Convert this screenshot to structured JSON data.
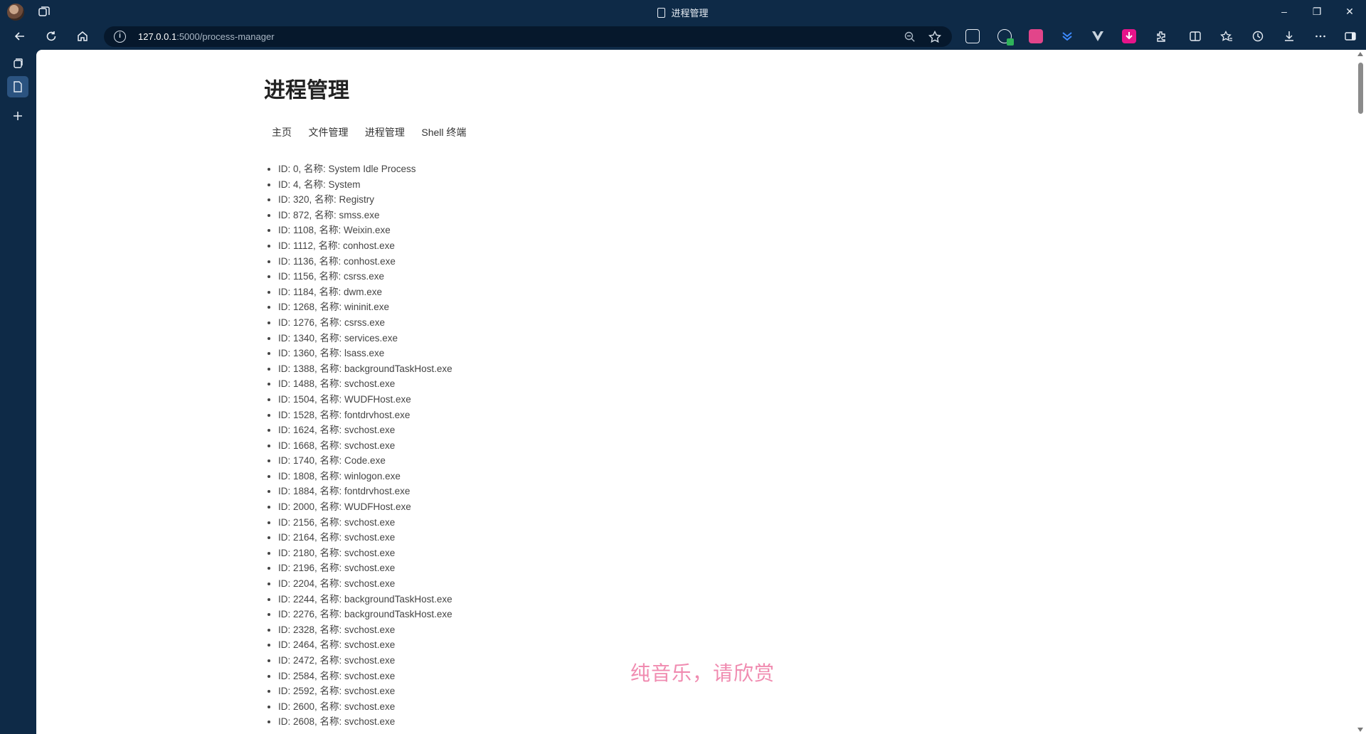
{
  "window": {
    "title": "进程管理",
    "controls": {
      "minimize": "–",
      "restore": "❐",
      "close": "✕"
    }
  },
  "toolbar": {
    "url_host": "127.0.0.1",
    "url_rest": ":5000/process-manager"
  },
  "page": {
    "title": "进程管理",
    "nav": [
      "主页",
      "文件管理",
      "进程管理",
      "Shell 终端"
    ],
    "label_id": "ID",
    "label_name": "名称",
    "processes": [
      "ID: 0, 名称: System Idle Process",
      "ID: 4, 名称: System",
      "ID: 320, 名称: Registry",
      "ID: 872, 名称: smss.exe",
      "ID: 1108, 名称: Weixin.exe",
      "ID: 1112, 名称: conhost.exe",
      "ID: 1136, 名称: conhost.exe",
      "ID: 1156, 名称: csrss.exe",
      "ID: 1184, 名称: dwm.exe",
      "ID: 1268, 名称: wininit.exe",
      "ID: 1276, 名称: csrss.exe",
      "ID: 1340, 名称: services.exe",
      "ID: 1360, 名称: lsass.exe",
      "ID: 1388, 名称: backgroundTaskHost.exe",
      "ID: 1488, 名称: svchost.exe",
      "ID: 1504, 名称: WUDFHost.exe",
      "ID: 1528, 名称: fontdrvhost.exe",
      "ID: 1624, 名称: svchost.exe",
      "ID: 1668, 名称: svchost.exe",
      "ID: 1740, 名称: Code.exe",
      "ID: 1808, 名称: winlogon.exe",
      "ID: 1884, 名称: fontdrvhost.exe",
      "ID: 2000, 名称: WUDFHost.exe",
      "ID: 2156, 名称: svchost.exe",
      "ID: 2164, 名称: svchost.exe",
      "ID: 2180, 名称: svchost.exe",
      "ID: 2196, 名称: svchost.exe",
      "ID: 2204, 名称: svchost.exe",
      "ID: 2244, 名称: backgroundTaskHost.exe",
      "ID: 2276, 名称: backgroundTaskHost.exe",
      "ID: 2328, 名称: svchost.exe",
      "ID: 2464, 名称: svchost.exe",
      "ID: 2472, 名称: svchost.exe",
      "ID: 2584, 名称: svchost.exe",
      "ID: 2592, 名称: svchost.exe",
      "ID: 2600, 名称: svchost.exe",
      "ID: 2608, 名称: svchost.exe"
    ]
  },
  "overlay": {
    "watermark": "纯音乐，请欣赏"
  },
  "colors": {
    "chrome_bg": "#0e2a47",
    "address_bg": "#06182c",
    "page_bg": "#ffffff",
    "watermark": "#f08bb0"
  }
}
